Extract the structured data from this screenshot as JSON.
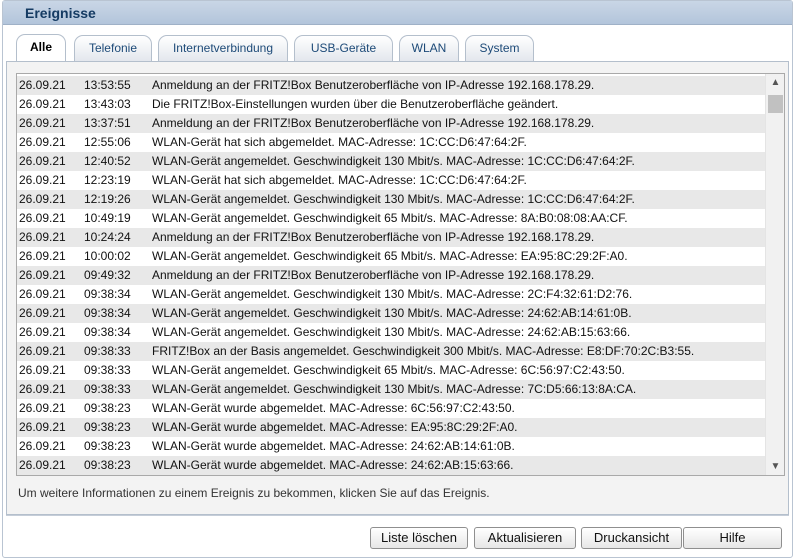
{
  "title": "Ereignisse",
  "tabs": [
    {
      "label": "Alle",
      "active": true
    },
    {
      "label": "Telefonie",
      "active": false
    },
    {
      "label": "Internetverbindung",
      "active": false
    },
    {
      "label": "USB-Geräte",
      "active": false
    },
    {
      "label": "WLAN",
      "active": false
    },
    {
      "label": "System",
      "active": false
    }
  ],
  "events": [
    {
      "date": "26.09.21",
      "time": "13:53:55",
      "message": "Anmeldung an der FRITZ!Box Benutzeroberfläche von IP-Adresse 192.168.178.29."
    },
    {
      "date": "26.09.21",
      "time": "13:43:03",
      "message": "Die FRITZ!Box-Einstellungen wurden über die Benutzeroberfläche geändert."
    },
    {
      "date": "26.09.21",
      "time": "13:37:51",
      "message": "Anmeldung an der FRITZ!Box Benutzeroberfläche von IP-Adresse 192.168.178.29."
    },
    {
      "date": "26.09.21",
      "time": "12:55:06",
      "message": "WLAN-Gerät hat sich abgemeldet. MAC-Adresse: 1C:CC:D6:47:64:2F."
    },
    {
      "date": "26.09.21",
      "time": "12:40:52",
      "message": "WLAN-Gerät angemeldet. Geschwindigkeit 130 Mbit/s. MAC-Adresse: 1C:CC:D6:47:64:2F."
    },
    {
      "date": "26.09.21",
      "time": "12:23:19",
      "message": "WLAN-Gerät hat sich abgemeldet. MAC-Adresse: 1C:CC:D6:47:64:2F."
    },
    {
      "date": "26.09.21",
      "time": "12:19:26",
      "message": "WLAN-Gerät angemeldet. Geschwindigkeit 130 Mbit/s. MAC-Adresse: 1C:CC:D6:47:64:2F."
    },
    {
      "date": "26.09.21",
      "time": "10:49:19",
      "message": "WLAN-Gerät angemeldet. Geschwindigkeit 65 Mbit/s. MAC-Adresse: 8A:B0:08:08:AA:CF."
    },
    {
      "date": "26.09.21",
      "time": "10:24:24",
      "message": "Anmeldung an der FRITZ!Box Benutzeroberfläche von IP-Adresse 192.168.178.29."
    },
    {
      "date": "26.09.21",
      "time": "10:00:02",
      "message": "WLAN-Gerät angemeldet. Geschwindigkeit 65 Mbit/s. MAC-Adresse: EA:95:8C:29:2F:A0."
    },
    {
      "date": "26.09.21",
      "time": "09:49:32",
      "message": "Anmeldung an der FRITZ!Box Benutzeroberfläche von IP-Adresse 192.168.178.29."
    },
    {
      "date": "26.09.21",
      "time": "09:38:34",
      "message": "WLAN-Gerät angemeldet. Geschwindigkeit 130 Mbit/s. MAC-Adresse: 2C:F4:32:61:D2:76."
    },
    {
      "date": "26.09.21",
      "time": "09:38:34",
      "message": "WLAN-Gerät angemeldet. Geschwindigkeit 130 Mbit/s. MAC-Adresse: 24:62:AB:14:61:0B."
    },
    {
      "date": "26.09.21",
      "time": "09:38:34",
      "message": "WLAN-Gerät angemeldet. Geschwindigkeit 130 Mbit/s. MAC-Adresse: 24:62:AB:15:63:66."
    },
    {
      "date": "26.09.21",
      "time": "09:38:33",
      "message": "FRITZ!Box an der Basis angemeldet. Geschwindigkeit 300 Mbit/s. MAC-Adresse: E8:DF:70:2C:B3:55."
    },
    {
      "date": "26.09.21",
      "time": "09:38:33",
      "message": "WLAN-Gerät angemeldet. Geschwindigkeit 65 Mbit/s. MAC-Adresse: 6C:56:97:C2:43:50."
    },
    {
      "date": "26.09.21",
      "time": "09:38:33",
      "message": "WLAN-Gerät angemeldet. Geschwindigkeit 130 Mbit/s. MAC-Adresse: 7C:D5:66:13:8A:CA."
    },
    {
      "date": "26.09.21",
      "time": "09:38:23",
      "message": "WLAN-Gerät wurde abgemeldet. MAC-Adresse: 6C:56:97:C2:43:50."
    },
    {
      "date": "26.09.21",
      "time": "09:38:23",
      "message": "WLAN-Gerät wurde abgemeldet. MAC-Adresse: EA:95:8C:29:2F:A0."
    },
    {
      "date": "26.09.21",
      "time": "09:38:23",
      "message": "WLAN-Gerät wurde abgemeldet. MAC-Adresse: 24:62:AB:14:61:0B."
    },
    {
      "date": "26.09.21",
      "time": "09:38:23",
      "message": "WLAN-Gerät wurde abgemeldet. MAC-Adresse: 24:62:AB:15:63:66."
    }
  ],
  "scrollbar": {
    "up_icon": "chevron-up-icon",
    "down_icon": "chevron-down-icon"
  },
  "info_text": "Um weitere Informationen zu einem Ereignis zu bekommen, klicken Sie auf das Ereignis.",
  "buttons": {
    "clear": "Liste löschen",
    "refresh": "Aktualisieren",
    "print": "Druckansicht",
    "help": "Hilfe"
  },
  "colors": {
    "title_text": "#153b63",
    "tab_text": "#1d4a78",
    "row_alt": "#e8e8e8"
  }
}
